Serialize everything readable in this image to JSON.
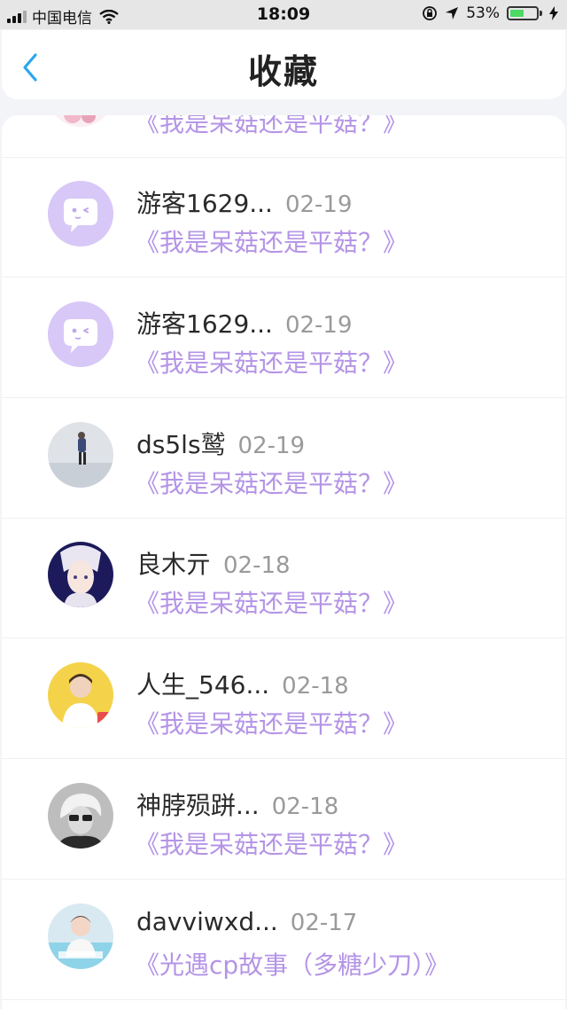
{
  "status_bar": {
    "carrier": "中国电信",
    "time": "18:09",
    "battery_percent": "53%",
    "battery_level": 0.53,
    "icons": [
      "signal-icon",
      "wifi-icon",
      "orientation-lock-icon",
      "location-arrow-icon",
      "battery-icon",
      "charging-bolt-icon"
    ]
  },
  "header": {
    "title": "收藏",
    "back_icon": "back-chevron-icon"
  },
  "colors": {
    "accent_purple": "#b494e6",
    "back_blue": "#2aa6f0",
    "battery_green": "#4cd964"
  },
  "favorites": [
    {
      "name": "",
      "date": "",
      "story": "《我是呆菇还是平菇？》",
      "avatar": "pink-avatar"
    },
    {
      "name": "游客1629...",
      "date": "02-19",
      "story": "《我是呆菇还是平菇？》",
      "avatar": "guest-chat-bubble-icon"
    },
    {
      "name": "游客1629...",
      "date": "02-19",
      "story": "《我是呆菇还是平菇？》",
      "avatar": "guest-chat-bubble-icon"
    },
    {
      "name": "ds5ls鹫",
      "date": "02-19",
      "story": "《我是呆菇还是平菇？》",
      "avatar": "photo-avatar"
    },
    {
      "name": "良木亓",
      "date": "02-18",
      "story": "《我是呆菇还是平菇？》",
      "avatar": "anime-avatar"
    },
    {
      "name": "人生_546...",
      "date": "02-18",
      "story": "《我是呆菇还是平菇？》",
      "avatar": "photo-avatar"
    },
    {
      "name": "神脖殒跰...",
      "date": "02-18",
      "story": "《我是呆菇还是平菇？》",
      "avatar": "photo-avatar"
    },
    {
      "name": "davviwxd...",
      "date": "02-17",
      "story": "《光遇cp故事（多糖少刀）》",
      "avatar": "photo-avatar"
    }
  ]
}
